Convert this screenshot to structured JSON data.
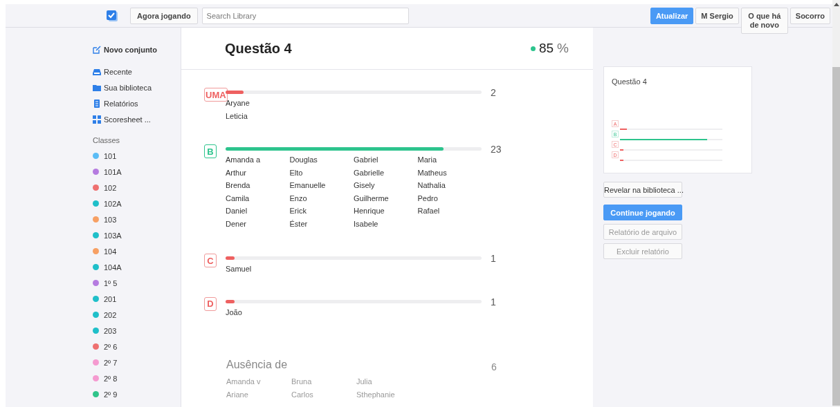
{
  "top_bar": {
    "now_playing": "Agora jogando",
    "search": {
      "placeholder": "Search Library"
    },
    "buttons": [
      {
        "label": "Atualizar",
        "kind": "primary"
      },
      {
        "label": "M Sergio",
        "kind": "secondary"
      },
      {
        "label": "O que há de novo",
        "kind": "secondary"
      },
      {
        "label": "Socorro",
        "kind": "secondary"
      }
    ]
  },
  "sidebar": {
    "new_set": "Novo conjunto",
    "nav": [
      {
        "label": "Recente",
        "kind": "recent"
      },
      {
        "label": "Sua biblioteca",
        "kind": "library"
      },
      {
        "label": "Relatórios",
        "kind": "reports"
      },
      {
        "label": "Scoresheet ...",
        "kind": "scoresheet"
      }
    ],
    "classes_heading": "Classes",
    "classes": [
      {
        "label": "101",
        "color": "#5bbcf5"
      },
      {
        "label": "101A",
        "color": "#b57be0"
      },
      {
        "label": "102",
        "color": "#ee7070"
      },
      {
        "label": "102A",
        "color": "#1fbfc9"
      },
      {
        "label": "103",
        "color": "#f7a064"
      },
      {
        "label": "103A",
        "color": "#1fbfc9"
      },
      {
        "label": "104",
        "color": "#f7a064"
      },
      {
        "label": "104A",
        "color": "#1fbfc9"
      },
      {
        "label": "1º 5",
        "color": "#b57be0"
      },
      {
        "label": "201",
        "color": "#1fbfc9"
      },
      {
        "label": "202",
        "color": "#1fbfc9"
      },
      {
        "label": "203",
        "color": "#1fbfc9"
      },
      {
        "label": "2º 6",
        "color": "#ee7070"
      },
      {
        "label": "2º 7",
        "color": "#f59ad0"
      },
      {
        "label": "2º 8",
        "color": "#f59ad0"
      },
      {
        "label": "2º 9",
        "color": "#2fc48a"
      }
    ]
  },
  "question": {
    "title": "Questão 4",
    "score": "85",
    "score_unit": "%",
    "answers": [
      {
        "letter": "UMA",
        "correct": false,
        "level": 0.07,
        "count": "2",
        "name_columns": [
          [
            "Aryane",
            "Leticia"
          ]
        ]
      },
      {
        "letter": "B",
        "correct": true,
        "level": 0.85,
        "count": "23",
        "name_columns": [
          [
            "Amanda a",
            "Arthur",
            "Brenda",
            "Camila",
            "Daniel",
            "Dener"
          ],
          [
            "Douglas",
            "Elto",
            "Emanuelle",
            "Enzo",
            "Erick",
            "Éster"
          ],
          [
            "Gabriel",
            "Gabrielle",
            "Gisely",
            "Guilherme",
            "Henrique",
            "Isabele"
          ],
          [
            "Maria",
            "Matheus",
            "Nathalia",
            "Pedro",
            "Rafael"
          ]
        ]
      },
      {
        "letter": "C",
        "correct": false,
        "level": 0.035,
        "count": "1",
        "name_columns": [
          [
            "Samuel"
          ]
        ]
      },
      {
        "letter": "D",
        "correct": false,
        "level": 0.035,
        "count": "1",
        "name_columns": [
          [
            "João"
          ]
        ]
      }
    ],
    "absent": {
      "title": "Ausência de",
      "count": "6",
      "name_columns": [
        [
          "Amanda v",
          "Ariane"
        ],
        [
          "Bruna",
          "Carlos"
        ],
        [
          "Julia",
          "Sthephanie"
        ]
      ]
    }
  },
  "preview": {
    "title": "Questão 4",
    "answers": [
      {
        "letter": "A",
        "correct": false,
        "level": 0.07
      },
      {
        "letter": "B",
        "correct": true,
        "level": 0.85
      },
      {
        "letter": "C",
        "correct": false,
        "level": 0.035
      },
      {
        "letter": "D",
        "correct": false,
        "level": 0.035
      }
    ]
  },
  "actions": [
    {
      "label": "Revelar na biblioteca ...",
      "kind": "secondary"
    },
    {
      "label": "Continue jogando",
      "kind": "primary"
    },
    {
      "label": "Relatório de arquivo",
      "kind": "muted"
    },
    {
      "label": "Excluir relatório",
      "kind": "muted"
    }
  ]
}
